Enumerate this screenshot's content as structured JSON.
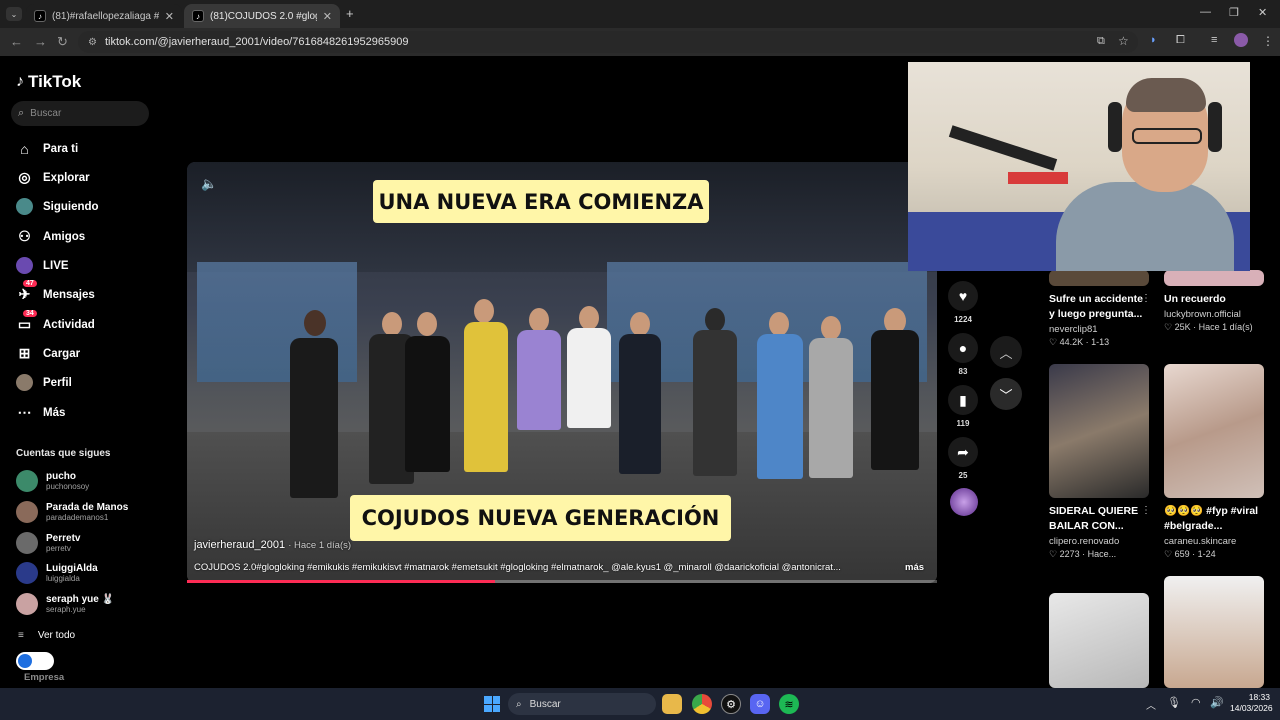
{
  "browser": {
    "tabs": [
      {
        "title": "(81)#rafaellopezaliaga #politica",
        "active": false
      },
      {
        "title": "(81)COJUDOS 2.0 #glogloking",
        "active": true
      }
    ],
    "url": "tiktok.com/@javierheraud_2001/video/7616848261952965909"
  },
  "sidebar": {
    "logo": "TikTok",
    "search_placeholder": "Buscar",
    "nav": [
      {
        "label": "Para ti",
        "icon": "home-icon"
      },
      {
        "label": "Explorar",
        "icon": "compass-icon"
      },
      {
        "label": "Siguiendo",
        "icon": "avatar-icon"
      },
      {
        "label": "Amigos",
        "icon": "friends-icon"
      },
      {
        "label": "LIVE",
        "icon": "live-icon"
      },
      {
        "label": "Mensajes",
        "icon": "message-icon",
        "badge": "47"
      },
      {
        "label": "Actividad",
        "icon": "activity-icon",
        "badge": "34"
      },
      {
        "label": "Cargar",
        "icon": "upload-icon"
      },
      {
        "label": "Perfil",
        "icon": "profile-icon"
      },
      {
        "label": "Más",
        "icon": "more-icon"
      }
    ],
    "following_title": "Cuentas que sigues",
    "following": [
      {
        "name": "pucho",
        "handle": "puchonosoy",
        "color": "#3c8a6a"
      },
      {
        "name": "Parada de Manos",
        "handle": "paradademanos1",
        "color": "#8a6a5a"
      },
      {
        "name": "Perretv",
        "handle": "perretv",
        "color": "#6a6a6a"
      },
      {
        "name": "LuiggiAlda",
        "handle": "luiggialda",
        "color": "#2a3a8a"
      },
      {
        "name": "seraph yue 🐰",
        "handle": "seraph.yue",
        "color": "#c9a2a2"
      }
    ],
    "see_all": "Ver todo",
    "company": "Empresa"
  },
  "video": {
    "caption_top": "UNA NUEVA ERA COMIENZA",
    "caption_bottom": "COJUDOS NUEVA GENERACIÓN",
    "author": "javierheraud_2001",
    "time": "· Hace 1 día(s)",
    "description": "COJUDOS 2.0#glogloking #emikukis #emikukisvt #matnarok #emetsukit #glogloking #elmatnarok_ @ale.kyus1 @_minaroll @daarickoficial @antonicrat...",
    "more": "más",
    "progress": 0.41
  },
  "actions": {
    "likes": "1224",
    "comments": "83",
    "saves": "119",
    "shares": "25"
  },
  "grid": [
    {
      "title": "Sufre un accidente y luego pregunta...",
      "author": "neverclip81",
      "stats": "44.2K · 1-13"
    },
    {
      "title": "Un recuerdo",
      "author": "luckybrown.official",
      "stats": "25K · Hace 1 día(s)"
    },
    {
      "title": "SIDERAL QUIERE BAILAR CON...",
      "author": "clipero.renovado",
      "stats": "2273 · Hace..."
    },
    {
      "title": "🥺🥺🥺 #fyp #viral #belgrade...",
      "author": "caraneu.skincare",
      "stats": "659 · 1-24"
    }
  ],
  "taskbar": {
    "search": "Buscar",
    "time": "18:33",
    "date": "14/03/2026"
  },
  "colors": {
    "accent": "#fe2c55",
    "caption_bg": "#fff6a8",
    "taskbar": "#1c2230"
  }
}
